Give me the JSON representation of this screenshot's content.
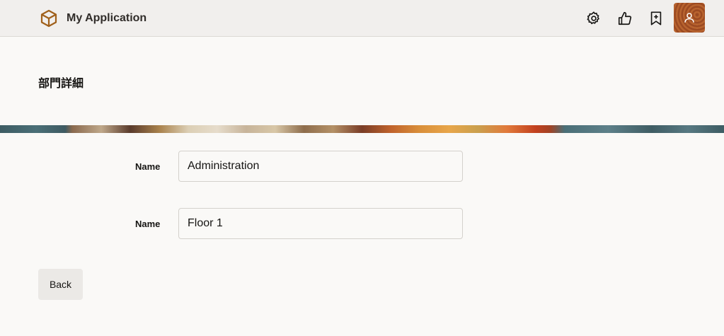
{
  "header": {
    "title": "My Application",
    "icons": [
      "cube-logo-icon",
      "gear-icon",
      "thumbs-up-icon",
      "bookmark-add-icon",
      "user-icon"
    ],
    "accent_color": "#9c4a22"
  },
  "page": {
    "title": "部門詳細"
  },
  "form": {
    "fields": [
      {
        "label": "Name",
        "value": "Administration"
      },
      {
        "label": "Name",
        "value": "Floor 1"
      }
    ]
  },
  "actions": {
    "back_label": "Back"
  }
}
